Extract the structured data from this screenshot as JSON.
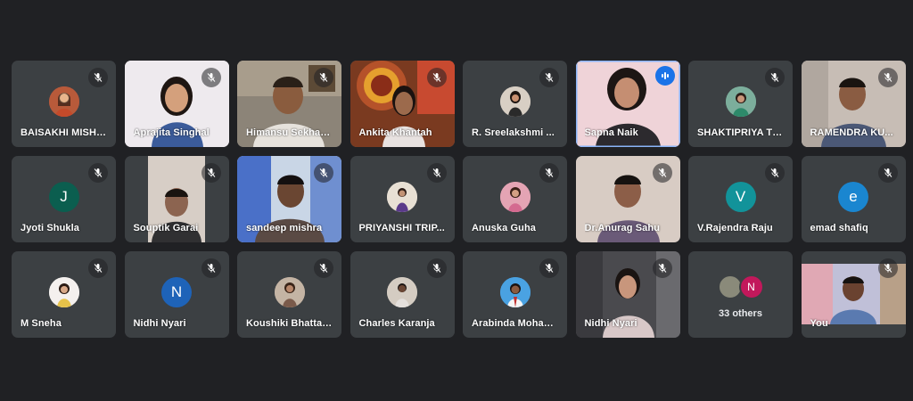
{
  "colors": {
    "background": "#202124",
    "tile": "#3c4043",
    "active_speaker": "#8ab4f8",
    "speaking_badge": "#1a73e8"
  },
  "participants": [
    {
      "name": "BAISAKHI MISHRA",
      "muted": true
    },
    {
      "name": "Aprajita Singhal",
      "muted": true
    },
    {
      "name": "Himansu Sekhar Rout",
      "muted": true
    },
    {
      "name": "Ankita Khantah",
      "muted": true
    },
    {
      "name": "R. Sreelakshmi ...",
      "muted": true
    },
    {
      "name": "Sapna Naik",
      "muted": false,
      "speaking": true
    },
    {
      "name": "SHAKTIPRIYA TR...",
      "muted": true
    },
    {
      "name": "RAMENDRA KU...",
      "muted": true
    },
    {
      "name": "Jyoti Shukla",
      "muted": true,
      "initial": "J"
    },
    {
      "name": "Souptik Garai",
      "muted": true
    },
    {
      "name": "sandeep mishra",
      "muted": true
    },
    {
      "name": "PRIYANSHI TRIP...",
      "muted": true
    },
    {
      "name": "Anuska Guha",
      "muted": true
    },
    {
      "name": "Dr.Anurag Sahu",
      "muted": true
    },
    {
      "name": "V.Rajendra Raju",
      "muted": true,
      "initial": "V"
    },
    {
      "name": "emad shafiq",
      "muted": true,
      "initial": "e"
    },
    {
      "name": "M Sneha",
      "muted": true
    },
    {
      "name": "Nidhi Nyari",
      "muted": true,
      "initial": "N"
    },
    {
      "name": "Koushiki Bhattacharya",
      "muted": true
    },
    {
      "name": "Charles Karanja",
      "muted": true
    },
    {
      "name": "Arabinda Mohanty",
      "muted": true
    },
    {
      "name": "Nidhi Nyari",
      "muted": true
    },
    {
      "others_label": "33 others",
      "mini_initial": "N"
    },
    {
      "name": "You",
      "muted": true
    }
  ]
}
